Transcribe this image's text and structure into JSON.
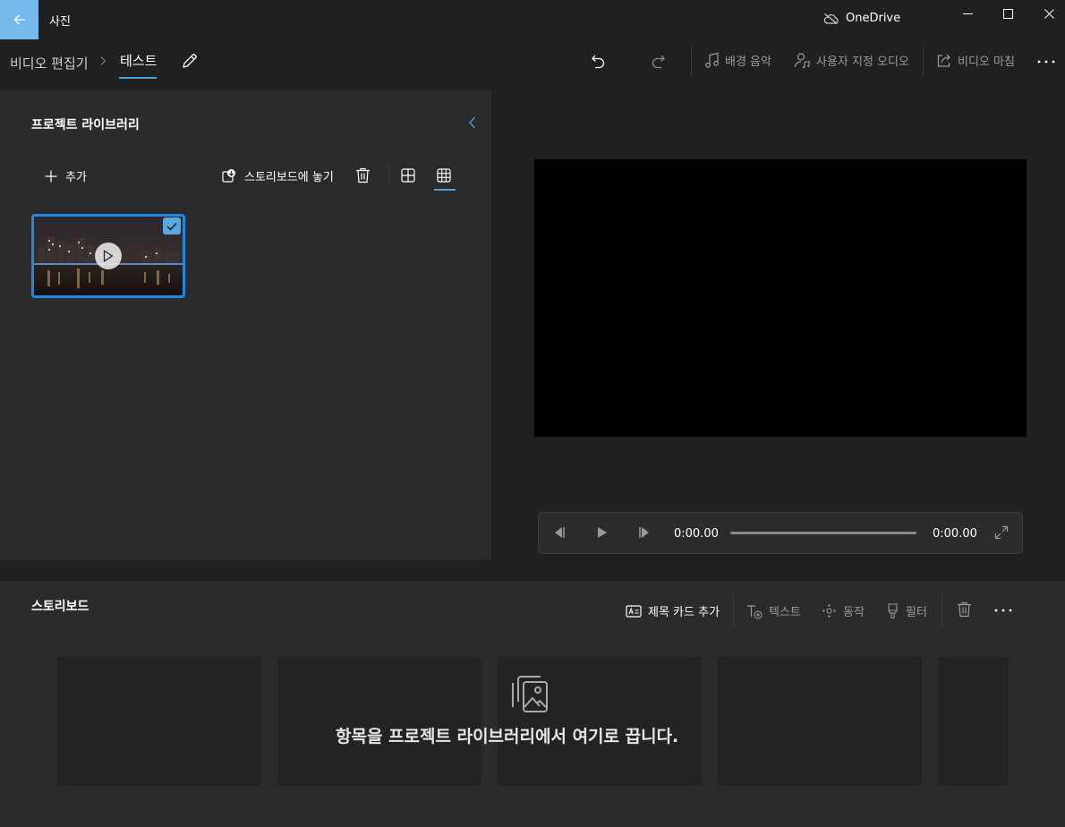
{
  "titlebar": {
    "app_title": "사진",
    "cloud_label": "OneDrive"
  },
  "nav": {
    "breadcrumb_root": "비디오 편집기",
    "breadcrumb_current": "테스트",
    "commands": {
      "background_music": "배경 음악",
      "custom_audio": "사용자 지정 오디오",
      "finish_video": "비디오 마침"
    }
  },
  "library": {
    "title": "프로젝트 라이브러리",
    "add_label": "추가",
    "place_label": "스토리보드에 놓기",
    "items": [
      {
        "selected": true
      }
    ]
  },
  "player": {
    "current_time": "0:00.00",
    "total_time": "0:00.00",
    "progress": 0
  },
  "storyboard": {
    "title": "스토리보드",
    "commands": {
      "add_title_card": "제목 카드 추가",
      "text": "텍스트",
      "motion": "동작",
      "filter": "필터"
    },
    "drop_hint": "항목을 프로젝트 라이브러리에서 여기로 끕니다."
  },
  "colors": {
    "accent": "#1e88e5",
    "back_button": "#76b9ed",
    "background": "#202020",
    "panel": "#2b2b2b"
  },
  "icons": [
    "back-arrow-icon",
    "cloud-off-icon",
    "minimize-icon",
    "maximize-icon",
    "close-icon",
    "chevron-right-icon",
    "pencil-icon",
    "undo-icon",
    "redo-icon",
    "music-note-icon",
    "person-audio-icon",
    "share-icon",
    "more-icon",
    "chevron-left-icon",
    "plus-icon",
    "place-icon",
    "trash-icon",
    "grid-large-icon",
    "grid-small-icon",
    "check-icon",
    "play-icon",
    "previous-frame-icon",
    "next-frame-icon",
    "fullscreen-icon",
    "title-card-icon",
    "text-icon",
    "motion-icon",
    "filter-icon",
    "image-stack-icon"
  ]
}
